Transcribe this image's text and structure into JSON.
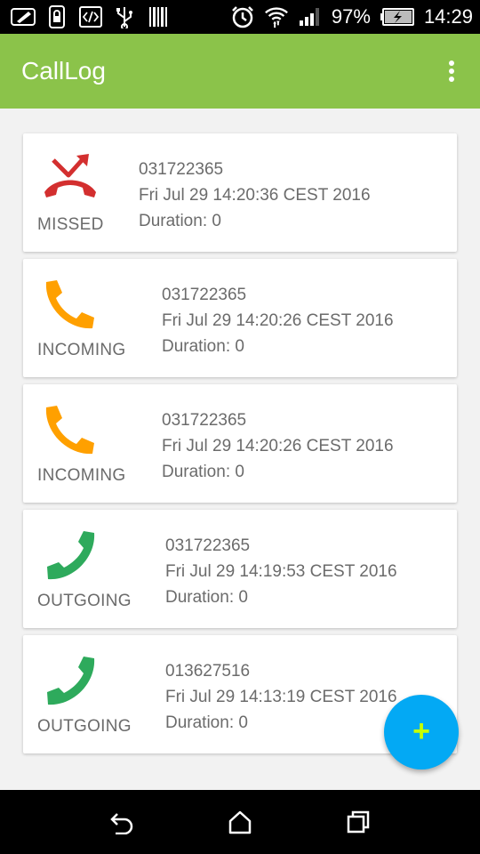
{
  "status_bar": {
    "battery": "97%",
    "time": "14:29",
    "left_icons": [
      "edit-icon",
      "lock-icon",
      "code-icon",
      "usb-icon",
      "barcode-icon"
    ],
    "right_icons": [
      "alarm-icon",
      "wifi-icon",
      "signal-icon",
      "battery-icon"
    ]
  },
  "app_bar": {
    "title": "CallLog",
    "overflow_icon": "more-vert-icon"
  },
  "calls": [
    {
      "type": "MISSED",
      "number": "031722365",
      "date": "Fri Jul 29 14:20:36 CEST 2016",
      "duration": "Duration:  0",
      "icon": "missed-call-icon",
      "color": "#d32f2f"
    },
    {
      "type": "INCOMING",
      "number": "031722365",
      "date": "Fri Jul 29 14:20:26 CEST 2016",
      "duration": "Duration: 0",
      "icon": "incoming-call-icon",
      "color": "#ffa000"
    },
    {
      "type": "INCOMING",
      "number": "031722365",
      "date": "Fri Jul 29 14:20:26 CEST 2016",
      "duration": "Duration: 0",
      "icon": "incoming-call-icon",
      "color": "#ffa000"
    },
    {
      "type": "OUTGOING",
      "number": "031722365",
      "date": "Fri Jul 29 14:19:53 CEST 2016",
      "duration": "Duration: 0",
      "icon": "outgoing-call-icon",
      "color": "#2eaa5c"
    },
    {
      "type": "OUTGOING",
      "number": "013627516",
      "date": "Fri Jul 29 14:13:19 CEST 2016",
      "duration": "Duration:  0",
      "icon": "outgoing-call-icon",
      "color": "#2eaa5c"
    }
  ],
  "fab": {
    "label": "+",
    "icon": "add-icon",
    "color": "#03a9f4"
  },
  "nav_bar": {
    "icons": [
      "back-icon",
      "home-icon",
      "recents-icon"
    ]
  },
  "colors": {
    "app_bar": "#8bc34a",
    "background": "#f2f2f2"
  }
}
